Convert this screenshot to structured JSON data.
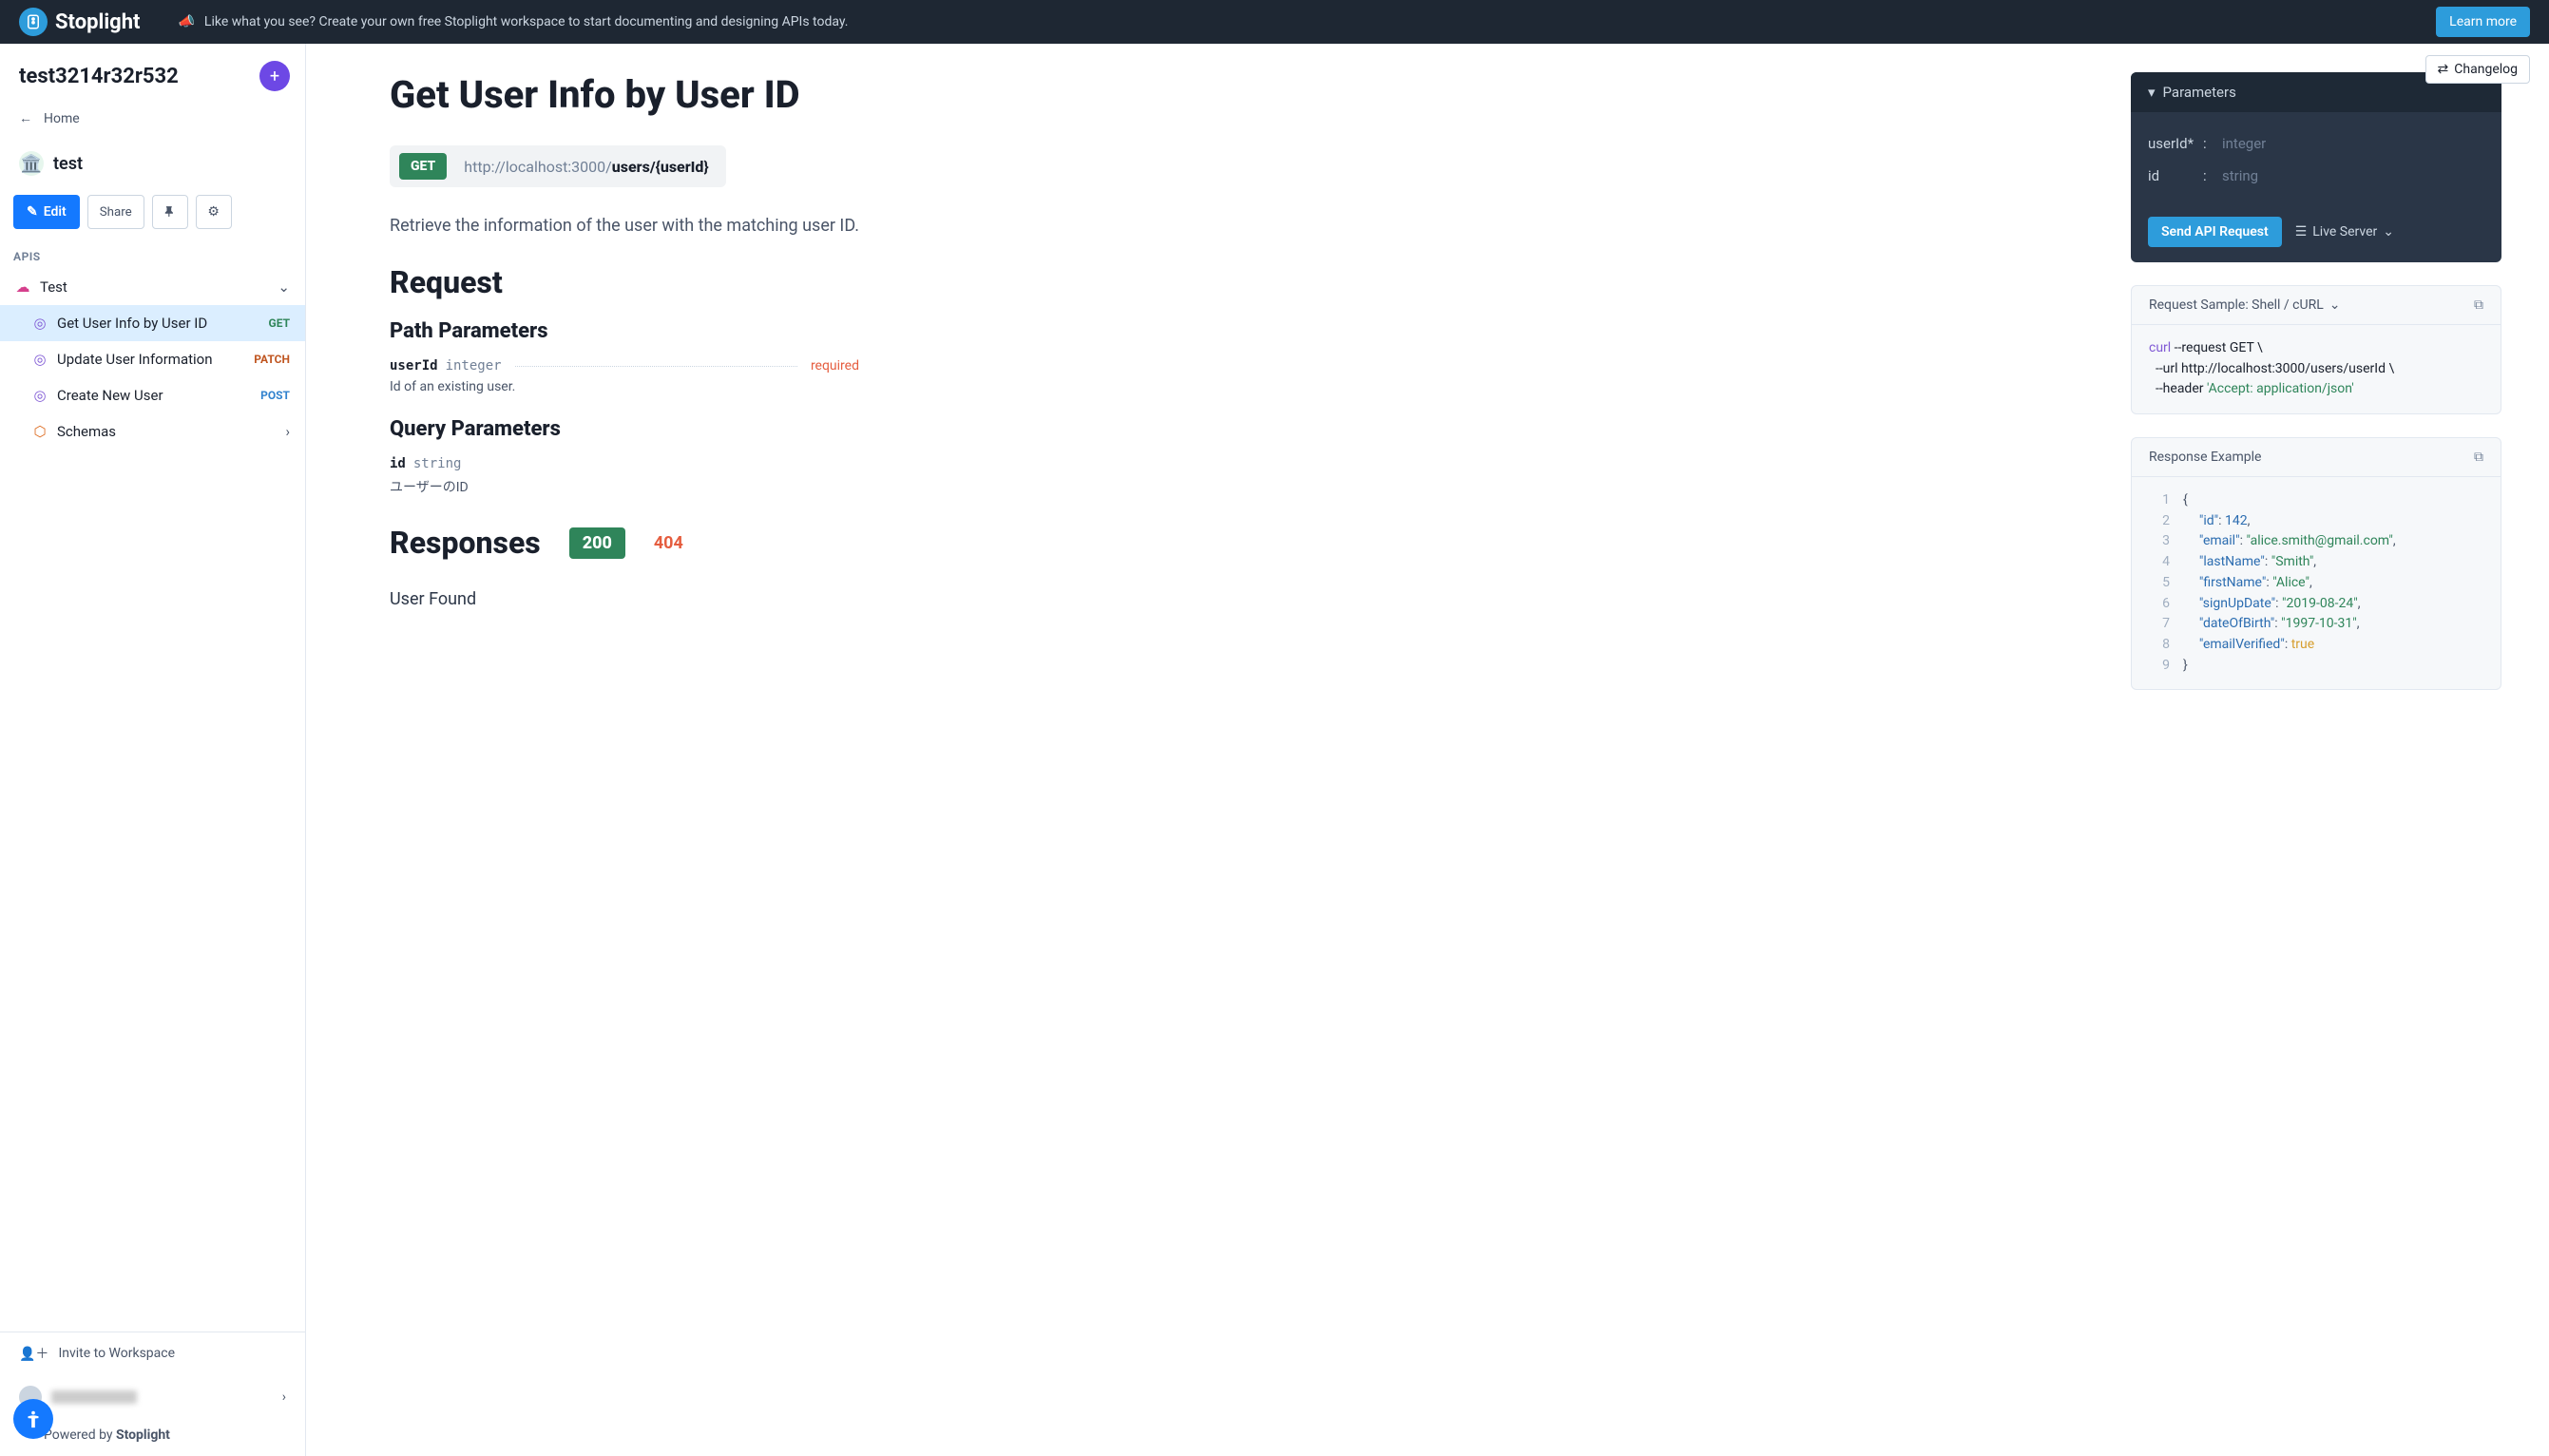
{
  "banner": {
    "brand": "Stoplight",
    "message": "Like what you see? Create your own free Stoplight workspace to start documenting and designing APIs today.",
    "learn_more": "Learn more"
  },
  "sidebar": {
    "workspace": "test3214r32r532",
    "home": "Home",
    "project_name": "test",
    "edit": "Edit",
    "share": "Share",
    "apis_label": "APIS",
    "tree": {
      "root": "Test",
      "items": [
        {
          "label": "Get User Info by User ID",
          "method": "GET",
          "selected": true
        },
        {
          "label": "Update User Information",
          "method": "PATCH",
          "selected": false
        },
        {
          "label": "Create New User",
          "method": "POST",
          "selected": false
        }
      ],
      "schemas": "Schemas"
    },
    "invite": "Invite to Workspace",
    "powered_prefix": "Powered by ",
    "powered_brand": "Stoplight"
  },
  "main": {
    "changelog": "Changelog",
    "title": "Get User Info by User ID",
    "method": "GET",
    "url_prefix": "http://localhost:3000/",
    "url_path": "users/{userId}",
    "description": "Retrieve the information of the user with the matching user ID.",
    "request_heading": "Request",
    "path_params_heading": "Path Parameters",
    "query_params_heading": "Query Parameters",
    "path_param": {
      "name": "userId",
      "type": "integer",
      "required": "required",
      "desc": "Id of an existing user."
    },
    "query_param": {
      "name": "id",
      "type": "string",
      "desc": "ユーザーのID"
    },
    "responses_heading": "Responses",
    "resp_200": "200",
    "resp_404": "404",
    "user_found": "User Found"
  },
  "panel": {
    "parameters_label": "Parameters",
    "rows": [
      {
        "name": "userId*",
        "type": "integer"
      },
      {
        "name": "id",
        "type": "string"
      }
    ],
    "send": "Send API Request",
    "server": "Live Server",
    "sample_label": "Request Sample: Shell / cURL",
    "sample_line1_a": "curl",
    "sample_line1_b": " --request GET \\",
    "sample_line2": "  --url http://localhost:3000/users/userId \\",
    "sample_line3_a": "  --header ",
    "sample_line3_b": "'Accept: application/json'",
    "response_label": "Response Example",
    "json": {
      "id": 142,
      "email": "alice.smith@gmail.com",
      "lastName": "Smith",
      "firstName": "Alice",
      "signUpDate": "2019-08-24",
      "dateOfBirth": "1997-10-31",
      "emailVerified": true
    }
  }
}
